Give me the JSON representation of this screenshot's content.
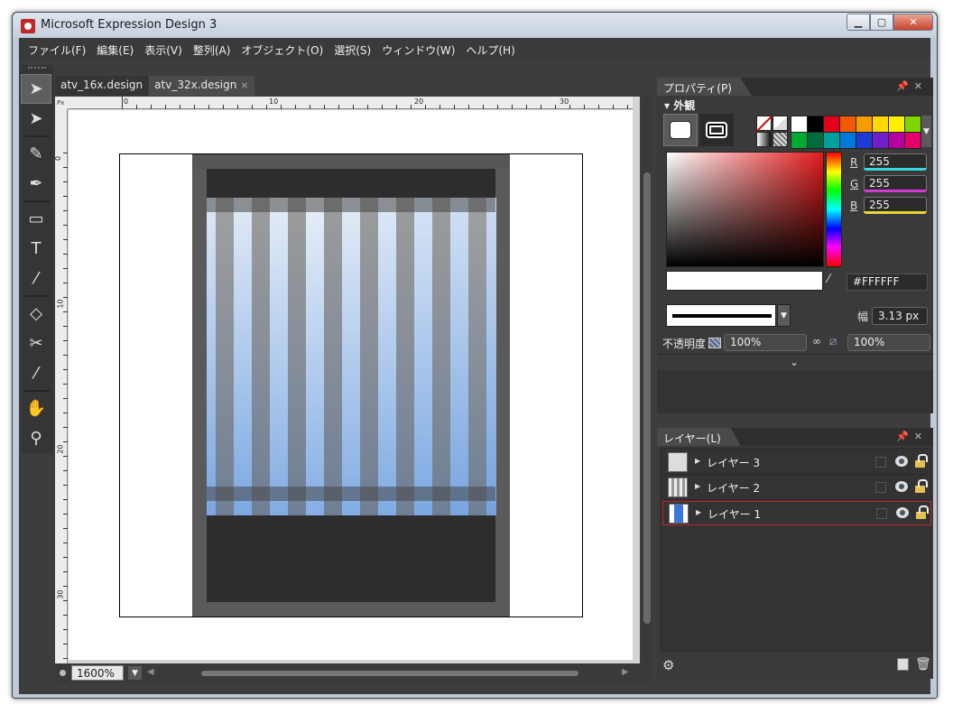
{
  "window": {
    "title": "Microsoft Expression Design 3"
  },
  "menu": [
    "ファイル(F)",
    "編集(E)",
    "表示(V)",
    "整列(A)",
    "オブジェクト(O)",
    "選択(S)",
    "ウィンドウ(W)",
    "ヘルプ(H)"
  ],
  "tools": [
    {
      "name": "selection-tool-icon",
      "glyph": "➤"
    },
    {
      "name": "direct-selection-tool-icon",
      "glyph": "➤"
    },
    {
      "name": "brush-tool-icon",
      "glyph": "✎"
    },
    {
      "name": "pen-tool-icon",
      "glyph": "✒"
    },
    {
      "name": "rectangle-tool-icon",
      "glyph": "▭"
    },
    {
      "name": "text-tool-icon",
      "glyph": "T"
    },
    {
      "name": "gradient-tool-icon",
      "glyph": "⁄"
    },
    {
      "name": "eraser-tool-icon",
      "glyph": "◇"
    },
    {
      "name": "scissors-tool-icon",
      "glyph": "✂"
    },
    {
      "name": "eyedropper-tool-icon",
      "glyph": "⁄"
    },
    {
      "name": "hand-tool-icon",
      "glyph": "✋"
    },
    {
      "name": "zoom-tool-icon",
      "glyph": "⚲"
    }
  ],
  "tabs": [
    {
      "label": "atv_16x.design",
      "active": false
    },
    {
      "label": "atv_32x.design",
      "active": true,
      "close": "×"
    }
  ],
  "ruler": {
    "unit": "Px",
    "h_labels": [
      "0",
      "10",
      "20",
      "30"
    ],
    "v_labels": [
      "0",
      "10",
      "20",
      "30"
    ]
  },
  "status": {
    "zoom": "1600%"
  },
  "properties": {
    "title": "プロパティ(P)",
    "section": "外観",
    "swatches": [
      "#ffffff",
      "#000000",
      "#e4001b",
      "#f05a00",
      "#f59d00",
      "#ffd800",
      "#fff000",
      "#7ed600",
      "#00a92f",
      "#006b3b",
      "#00a0a0",
      "#0077d9",
      "#1f3bd6",
      "#6d1fc9",
      "#b4009e",
      "#e4006a"
    ],
    "r_label": "R",
    "r_value": "255",
    "g_label": "G",
    "g_value": "255",
    "b_label": "B",
    "b_value": "255",
    "hex": "#FFFFFF",
    "width_label": "幅",
    "width_value": "3.13 px",
    "opacity_label": "不透明度",
    "opacity_value": "100%",
    "fill_opacity_value": "100%"
  },
  "layers": {
    "title": "レイヤー(L)",
    "items": [
      {
        "name": "レイヤー 3",
        "thumb": "white",
        "selected": false
      },
      {
        "name": "レイヤー 2",
        "thumb": "stripes",
        "selected": false
      },
      {
        "name": "レイヤー 1",
        "thumb": "blue",
        "selected": true
      }
    ]
  },
  "artwork": {
    "bar_colors_top": [
      "#dde8f5",
      "#a0a0a0",
      "#e2ebf6",
      "#9c9c9c",
      "#e5edf7",
      "#9c9c9c",
      "#e8eff8",
      "#9c9c9c",
      "#e4ecf6",
      "#9c9c9c",
      "#dfe9f6",
      "#9c9c9c",
      "#d8e5f5",
      "#9c9c9c",
      "#d2e1f4",
      "#a0a0a0",
      "#ccddf3"
    ],
    "bar_colors_bottom": [
      "#7aa6e0",
      "#6f7f95",
      "#7ca8e2",
      "#6f7f95",
      "#82ace3",
      "#6f7f95",
      "#85aee4",
      "#6f7f95",
      "#83ade4",
      "#6f7f95",
      "#80abe3",
      "#6f7f95",
      "#7ca8e2",
      "#6f7f95",
      "#78a5e0",
      "#6f7f95",
      "#74a2df"
    ]
  }
}
